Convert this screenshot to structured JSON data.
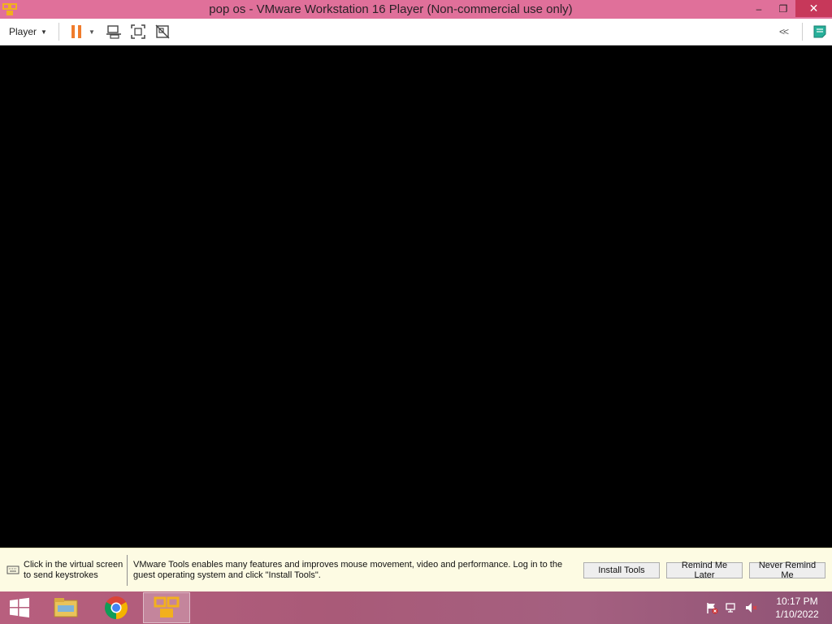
{
  "window": {
    "title": "pop os - VMware Workstation 16 Player (Non-commercial use only)",
    "app_icon": "vmware-icon",
    "controls": {
      "minimize": "–",
      "restore": "❐",
      "close": "✕"
    }
  },
  "toolbar": {
    "player_menu_label": "Player",
    "icons": [
      "pause-icon",
      "send-ctrl-alt-del-icon",
      "fullscreen-icon",
      "unity-icon",
      "collapse-icon",
      "notes-icon"
    ],
    "collapse_label": "<<"
  },
  "notification": {
    "keyboard_hint": "Click in the virtual screen to send keystrokes",
    "message": "VMware Tools enables many features and improves mouse movement, video and performance. Log in to the guest operating system and click \"Install Tools\".",
    "buttons": {
      "install": "Install Tools",
      "remind_later": "Remind Me Later",
      "never_remind": "Never Remind Me"
    }
  },
  "taskbar": {
    "apps": [
      "windows-start-icon",
      "file-explorer-icon",
      "chrome-icon",
      "vmware-icon"
    ],
    "active_app": "vmware-icon",
    "tray_icons": [
      "action-center-flag-icon",
      "network-icon",
      "volume-muted-icon"
    ],
    "clock": {
      "time": "10:17 PM",
      "date": "1/10/2022"
    }
  },
  "colors": {
    "titlebar": "#e0709a",
    "close_button": "#c7385a",
    "pause_accent": "#f07c2c",
    "notification_bg": "#fdfbe3",
    "vm_screen": "#000000"
  }
}
